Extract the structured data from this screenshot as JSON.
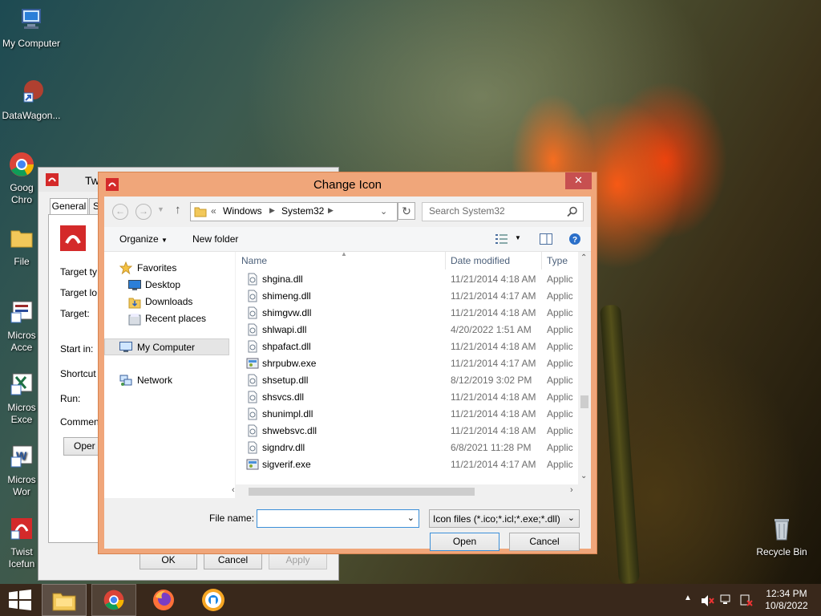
{
  "desktop_icons": [
    {
      "label": "My Computer",
      "icon": "computer-icon"
    },
    {
      "label": "DataWagon...",
      "icon": "shortcut-icon"
    },
    {
      "label": "Goog Chro",
      "icon": "chrome-icon"
    },
    {
      "label": "File",
      "icon": "folder-icon"
    },
    {
      "label": "Micros Acce",
      "icon": "access-icon"
    },
    {
      "label": "Micros Exce",
      "icon": "excel-icon"
    },
    {
      "label": "Micros Wor",
      "icon": "word-icon"
    },
    {
      "label": "Twist Icefun",
      "icon": "twist-icon"
    },
    {
      "label": "Recycle Bin",
      "icon": "recycle-bin-icon"
    }
  ],
  "bg_window": {
    "title": "Tw",
    "tabs": [
      "General",
      "S"
    ],
    "labels": [
      "Target ty",
      "Target lo",
      "Target:",
      "Start in:",
      "Shortcut",
      "Run:",
      "Commen"
    ],
    "open_button": "Oper",
    "ok": "OK",
    "cancel": "Cancel",
    "apply": "Apply"
  },
  "dialog": {
    "title": "Change Icon",
    "close": "✕",
    "breadcrumb": {
      "prefix": "«",
      "items": [
        "Windows",
        "System32"
      ]
    },
    "search_placeholder": "Search System32",
    "organize": "Organize",
    "new_folder": "New folder",
    "nav": {
      "favorites": "Favorites",
      "favorite_items": [
        "Desktop",
        "Downloads",
        "Recent places"
      ],
      "my_computer": "My Computer",
      "network": "Network"
    },
    "columns": {
      "name": "Name",
      "date": "Date modified",
      "type": "Type"
    },
    "files": [
      {
        "name": "shgina.dll",
        "date": "11/21/2014 4:18 AM",
        "type": "Applic"
      },
      {
        "name": "shimeng.dll",
        "date": "11/21/2014 4:17 AM",
        "type": "Applic"
      },
      {
        "name": "shimgvw.dll",
        "date": "11/21/2014 4:18 AM",
        "type": "Applic"
      },
      {
        "name": "shlwapi.dll",
        "date": "4/20/2022 1:51 AM",
        "type": "Applic"
      },
      {
        "name": "shpafact.dll",
        "date": "11/21/2014 4:18 AM",
        "type": "Applic"
      },
      {
        "name": "shrpubw.exe",
        "date": "11/21/2014 4:17 AM",
        "type": "Applic"
      },
      {
        "name": "shsetup.dll",
        "date": "8/12/2019 3:02 PM",
        "type": "Applic"
      },
      {
        "name": "shsvcs.dll",
        "date": "11/21/2014 4:18 AM",
        "type": "Applic"
      },
      {
        "name": "shunimpl.dll",
        "date": "11/21/2014 4:18 AM",
        "type": "Applic"
      },
      {
        "name": "shwebsvc.dll",
        "date": "11/21/2014 4:18 AM",
        "type": "Applic"
      },
      {
        "name": "signdrv.dll",
        "date": "6/8/2021 11:28 PM",
        "type": "Applic"
      },
      {
        "name": "sigverif.exe",
        "date": "11/21/2014 4:17 AM",
        "type": "Applic"
      }
    ],
    "file_name_label": "File name:",
    "file_name_value": "",
    "filter": "Icon files (*.ico;*.icl;*.exe;*.dll)",
    "open": "Open",
    "cancel": "Cancel"
  },
  "taskbar": {
    "time": "12:34 PM",
    "date": "10/8/2022",
    "apps": [
      "start-icon",
      "file-explorer-icon",
      "chrome-icon",
      "firefox-icon",
      "app-icon"
    ]
  }
}
